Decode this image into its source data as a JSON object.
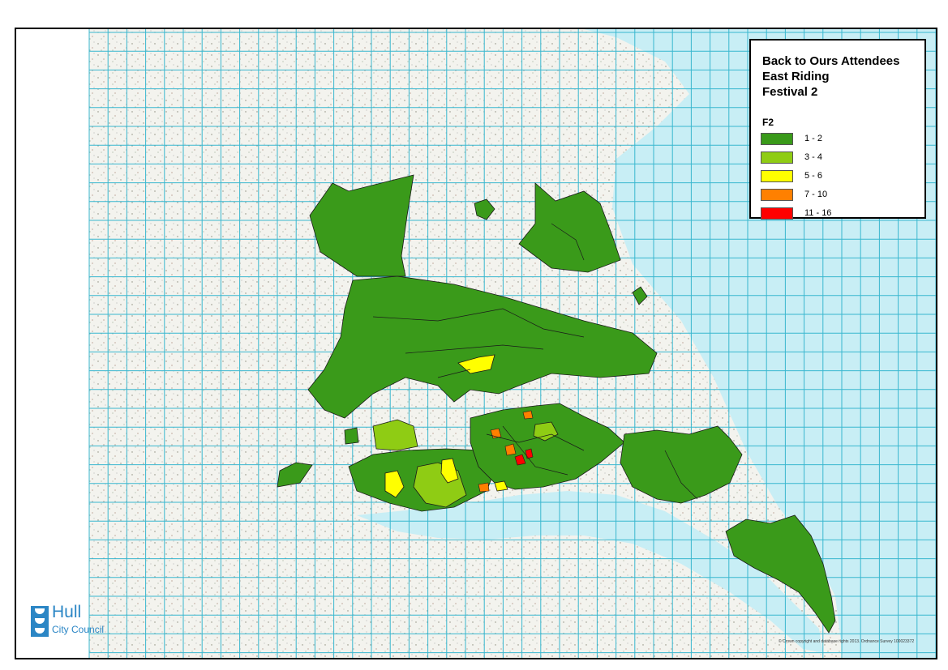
{
  "legend": {
    "title_line1": "Back to Ours Attendees",
    "title_line2": "East Riding",
    "title_line3": "Festival 2",
    "field": "F2",
    "classes": [
      {
        "label": "1 - 2",
        "color": "#3a9a1a"
      },
      {
        "label": "3 - 4",
        "color": "#8fcc14"
      },
      {
        "label": "5 - 6",
        "color": "#ffff00"
      },
      {
        "label": "7 - 10",
        "color": "#ff8000"
      },
      {
        "label": "11 - 16",
        "color": "#ff0000"
      }
    ]
  },
  "logo": {
    "name": "Hull",
    "sub": "City Council"
  },
  "copyright": "© Crown copyright and database rights 2013. Ordnance Survey 100023372",
  "colors": {
    "sea": "#c8eef5",
    "grid": "#39b7cf",
    "land": "#f1f1ec",
    "boundary": "#1a1a1a"
  }
}
